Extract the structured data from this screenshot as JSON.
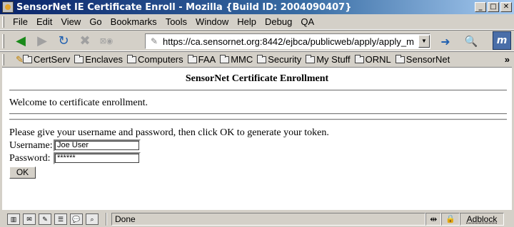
{
  "window": {
    "title": "SensorNet IE Certificate Enroll - Mozilla {Build ID: 2004090407}",
    "minimize_glyph": "_",
    "maximize_glyph": "□",
    "close_glyph": "✕"
  },
  "menu": {
    "items": [
      {
        "label": "File"
      },
      {
        "label": "Edit"
      },
      {
        "label": "View"
      },
      {
        "label": "Go"
      },
      {
        "label": "Bookmarks"
      },
      {
        "label": "Tools"
      },
      {
        "label": "Window"
      },
      {
        "label": "Help"
      },
      {
        "label": "Debug"
      },
      {
        "label": "QA"
      }
    ]
  },
  "nav": {
    "url": "https://ca.sensornet.org:8442/ejbca/publicweb/apply/apply_m",
    "icons": [
      "back-icon",
      "forward-icon",
      "reload-icon",
      "stop-icon",
      "go-icon",
      "search-icon",
      "mozilla-throbber-icon"
    ]
  },
  "bookmarks": {
    "items": [
      {
        "label": "CertServ"
      },
      {
        "label": "Enclaves"
      },
      {
        "label": "Computers"
      },
      {
        "label": "FAA"
      },
      {
        "label": "MMC"
      },
      {
        "label": "Security"
      },
      {
        "label": "My Stuff"
      },
      {
        "label": "ORNL"
      },
      {
        "label": "SensorNet"
      }
    ],
    "more": "»"
  },
  "page": {
    "heading": "SensorNet Certificate Enrollment",
    "welcome": "Welcome to certificate enrollment.",
    "instructions": "Please give your username and password, then click OK to generate your token.",
    "username_label": "Username:",
    "username_value": "Joe User",
    "password_label": "Password:",
    "password_value": "******",
    "ok_label": "OK"
  },
  "status": {
    "text": "Done",
    "adblock": "Adblock"
  },
  "colors": {
    "title_gradient_start": "#0a246a",
    "title_gradient_end": "#a6caf0",
    "chrome": "#d4d0c8"
  }
}
